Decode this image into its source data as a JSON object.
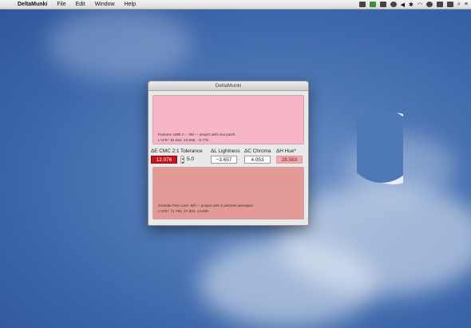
{
  "menubar": {
    "apple_glyph": "",
    "app_name": "DeltaMunki",
    "items": [
      "File",
      "Edit",
      "Window",
      "Help"
    ],
    "status_icons": [
      "dropbox-icon",
      "app-icon",
      "battery-icon",
      "gamepad-icon",
      "volume-icon",
      "bluetooth-icon",
      "wifi-icon",
      "time-machine-icon",
      "display-icon",
      "menu-extra-icon",
      "search-icon",
      "list-icon"
    ]
  },
  "window": {
    "title": "DeltaMunki",
    "reference": {
      "color": "#f7b6c7",
      "name": "Pantone 1895 C – 3M — project with one patch",
      "lab": "L*a*b*: 81.824, 23.945, −0.775"
    },
    "sample": {
      "color": "#e39a97",
      "name": "Grandta Pink color -6ifl — project with 5 patches averaged",
      "lab": "L*a*b*: 71.792, 27.822, 14.030"
    },
    "metrics": {
      "cmc_label": "ΔE CMC 2:1",
      "cmc_value": "12.076",
      "cmc_color": "#c8141e",
      "tolerance_label": "Tolerance",
      "tolerance_value": "5.0",
      "lightness_label": "ΔL Lightness",
      "lightness_value": "−3.657",
      "chroma_label": "ΔC Chroma",
      "chroma_value": "4.053",
      "hue_label": "ΔH Hue*",
      "hue_value": "28.563",
      "hue_color": "#f2a9ae"
    }
  }
}
